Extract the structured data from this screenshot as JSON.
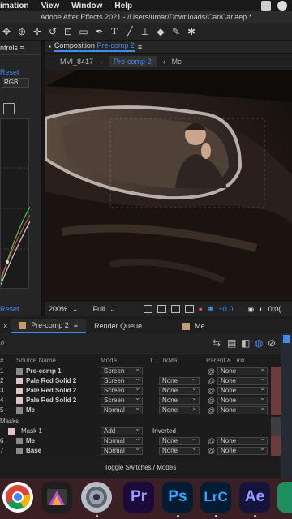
{
  "menubar": {
    "items": [
      "imation",
      "View",
      "Window",
      "Help"
    ]
  },
  "window": {
    "title": "Adobe After Effects 2021 - /Users/umar/Downloads/Car/Car.aep *"
  },
  "toolbar": {
    "icons": [
      "hand-tool",
      "zoom-tool",
      "rotate-tool",
      "camera-tool",
      "pan-behind-tool",
      "rectangle-tool",
      "pen-tool",
      "type-tool",
      "brush-tool",
      "clone-stamp-tool",
      "eraser-tool",
      "roto-brush-tool",
      "puppet-tool"
    ]
  },
  "left_panel": {
    "tab_label": "ntrols ≡",
    "reset_top": "Reset",
    "color_mode": "RGB",
    "reset_bottom": "Reset"
  },
  "composition": {
    "header_prefix": "Composition",
    "header_name": "Pre-comp 2",
    "header_menu": "≡",
    "crumbs": [
      "MVI_8417",
      "Pre-comp 2",
      "Me"
    ],
    "zoom": "200%",
    "resolution": "Full",
    "exposure": "+0.0",
    "timecode": "0;0("
  },
  "timeline": {
    "tabs": [
      {
        "label": "Pre-comp 2",
        "color": "#c49a6c",
        "active": true
      },
      {
        "label": "Render Queue",
        "color": "",
        "active": false
      },
      {
        "label": "Me",
        "color": "#c49a6c",
        "active": false
      }
    ],
    "columns": {
      "source_name": "Source Name",
      "mode": "Mode",
      "t": "T",
      "trkmat": "TrkMat",
      "parent": "Parent & Link"
    },
    "layers": [
      {
        "num": "1",
        "name": "Pre-comp 1",
        "mode": "Screen",
        "trkmat": "",
        "parent": "None",
        "swatch": "#c49a6c"
      },
      {
        "num": "2",
        "name": "Pale Red Solid 2",
        "mode": "Screen",
        "trkmat": "None",
        "parent": "None",
        "swatch": "#e0c2c2"
      },
      {
        "num": "3",
        "name": "Pale Red Solid 2",
        "mode": "Screen",
        "trkmat": "None",
        "parent": "None",
        "swatch": "#e0c2c2"
      },
      {
        "num": "4",
        "name": "Pale Red Solid 2",
        "mode": "Screen",
        "trkmat": "None",
        "parent": "None",
        "swatch": "#e0c2c2"
      },
      {
        "num": "5",
        "name": "Me",
        "mode": "Normal",
        "trkmat": "None",
        "parent": "None",
        "swatch": "#c49a6c"
      }
    ],
    "masks_label": "Masks",
    "mask": {
      "name": "Mask 1",
      "mode": "Add",
      "inverted": "Inverted"
    },
    "layers_after": [
      {
        "num": "6",
        "name": "Me",
        "mode": "Normal",
        "trkmat": "None",
        "parent": "None",
        "swatch": "#c49a6c"
      },
      {
        "num": "7",
        "name": "Base",
        "mode": "Normal",
        "trkmat": "None",
        "parent": "None",
        "swatch": "#c49a6c"
      }
    ],
    "footer": "Toggle Switches / Modes"
  },
  "dock": {
    "apps": [
      {
        "name": "chrome-icon",
        "label": "",
        "bg": "#ffffff",
        "fg": "#000000"
      },
      {
        "name": "final-cut-pro-icon",
        "label": "",
        "bg": "#222222",
        "fg": "#ffffff"
      },
      {
        "name": "compressor-icon",
        "label": "",
        "bg": "#9aa3ad",
        "fg": "#ffffff"
      },
      {
        "name": "premiere-pro-icon",
        "label": "Pr",
        "bg": "#1c0a3a",
        "fg": "#9999ff"
      },
      {
        "name": "photoshop-icon",
        "label": "Ps",
        "bg": "#031c33",
        "fg": "#31a8ff"
      },
      {
        "name": "lightroom-classic-icon",
        "label": "LrC",
        "bg": "#041c33",
        "fg": "#31a8ff"
      },
      {
        "name": "after-effects-icon",
        "label": "Ae",
        "bg": "#14143a",
        "fg": "#9999ff"
      },
      {
        "name": "app-icon-partial",
        "label": "",
        "bg": "#1d8f5e",
        "fg": "#ffffff"
      }
    ]
  },
  "colors": {
    "accent": "#3f8cf0",
    "label_tan": "#c49a6c",
    "label_pink": "#e0c2c2",
    "dock_bg": "#3a1f25"
  }
}
